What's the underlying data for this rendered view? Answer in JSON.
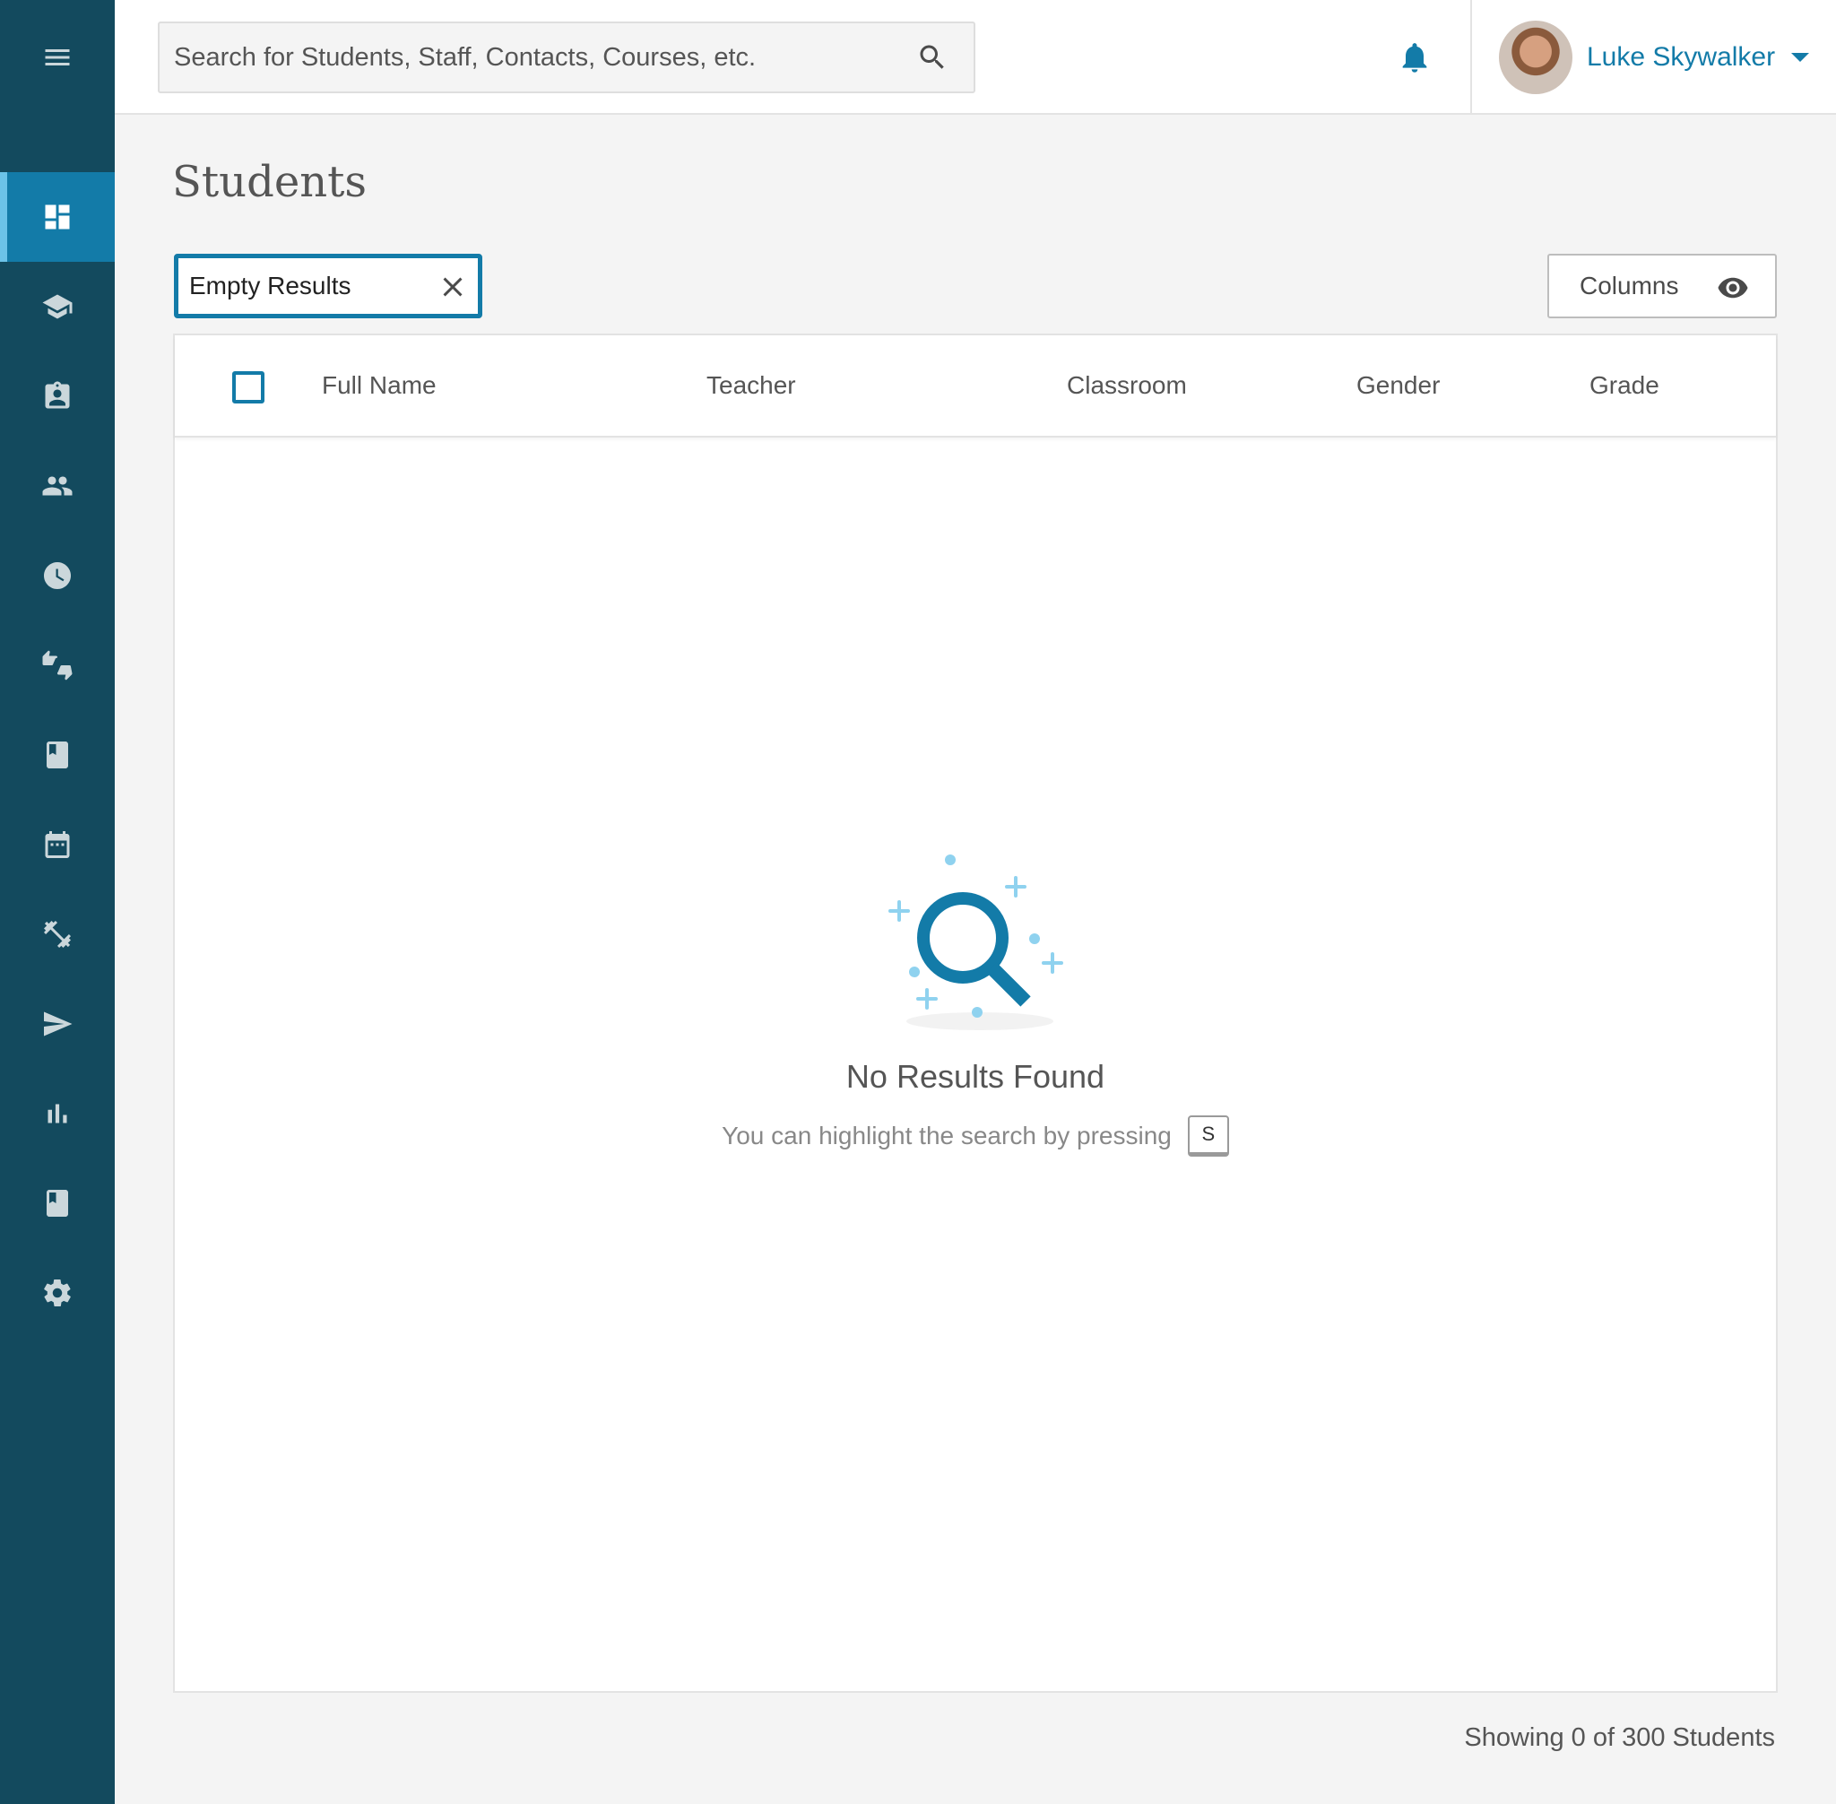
{
  "header": {
    "search_placeholder": "Search for Students, Staff, Contacts, Courses, etc.",
    "user_name": "Luke Skywalker"
  },
  "sidebar": {
    "items": [
      {
        "icon": "dashboard-icon",
        "active": true
      },
      {
        "icon": "graduation-cap-icon"
      },
      {
        "icon": "contact-badge-icon"
      },
      {
        "icon": "people-icon"
      },
      {
        "icon": "clock-icon"
      },
      {
        "icon": "thumbs-up-down-icon"
      },
      {
        "icon": "book-icon"
      },
      {
        "icon": "calendar-icon"
      },
      {
        "icon": "fitness-icon"
      },
      {
        "icon": "send-icon"
      },
      {
        "icon": "bar-chart-icon"
      },
      {
        "icon": "bookmark-book-icon"
      },
      {
        "icon": "settings-icon"
      }
    ]
  },
  "page": {
    "title": "Students",
    "filter_chip": "Empty Results",
    "columns_button": "Columns"
  },
  "table": {
    "columns": [
      "Full Name",
      "Teacher",
      "Classroom",
      "Gender",
      "Grade"
    ]
  },
  "empty_state": {
    "title": "No Results Found",
    "hint": "You can highlight the search by pressing",
    "key": "S"
  },
  "footer": {
    "count_text": "Showing 0 of 300 Students"
  },
  "colors": {
    "sidebar": "#134a5e",
    "accent": "#137ba8",
    "active_nav": "#137ba8",
    "sparkle": "#8fd2ef"
  }
}
